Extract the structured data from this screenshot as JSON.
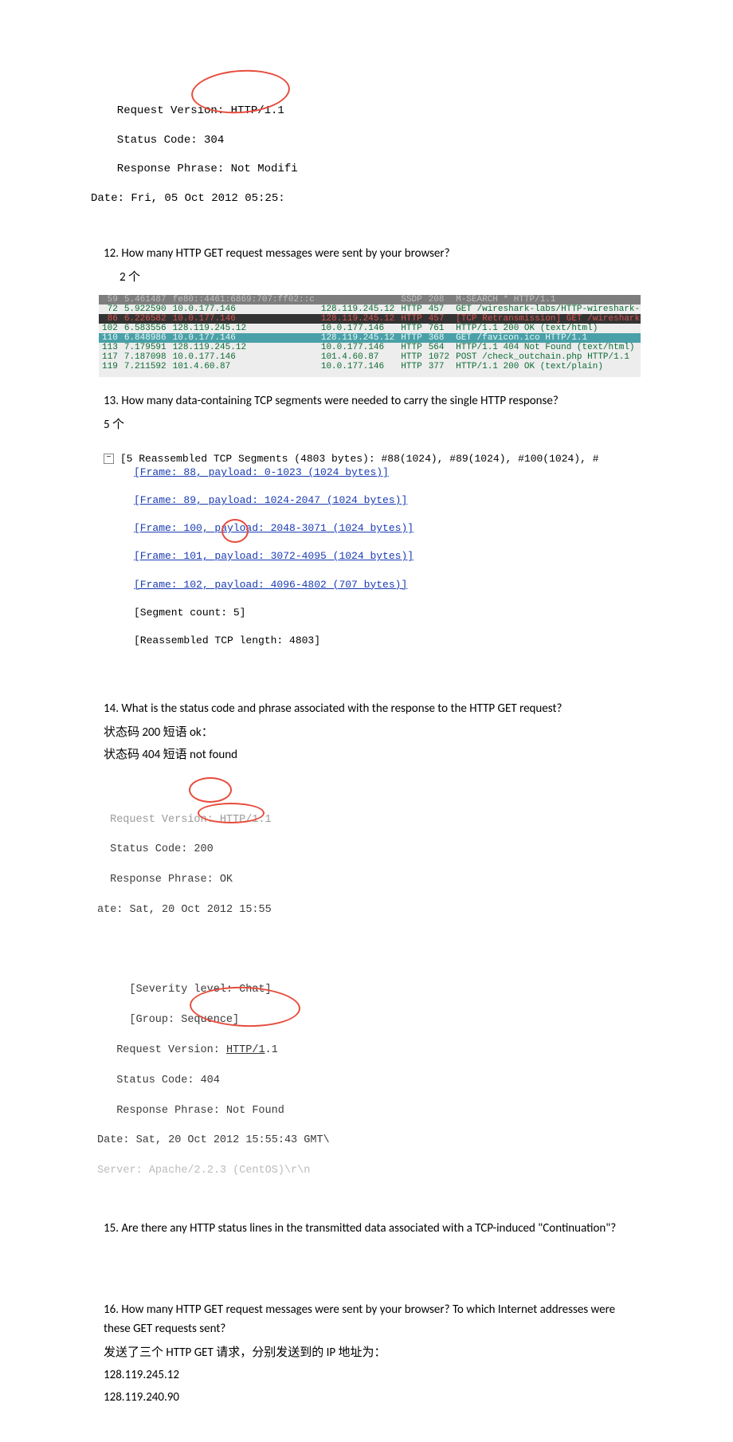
{
  "top_snippet": {
    "l1": "  Request Version: HTTP/1.1",
    "l2": "  Status Code: 304",
    "l3": "  Response Phrase: Not Modifi",
    "l4": "Date: Fri, 05 Oct 2012 05:25:"
  },
  "q12": {
    "q": "12. How many HTTP GET request messages were sent by your browser?",
    "a": "2 个"
  },
  "packets": [
    {
      "no": "59",
      "time": "5.461487",
      "src": "fe80::4461:6869:707:ff02::c",
      "dst": "",
      "proto": "SSDP",
      "len": "208",
      "info": "M-SEARCH * HTTP/1.1",
      "cls": "row-gray"
    },
    {
      "no": "72",
      "time": "5.922590",
      "src": "10.0.177.146",
      "dst": "128.119.245.12",
      "proto": "HTTP",
      "len": "457",
      "info": "GET /wireshark-labs/HTTP-wireshark-file",
      "cls": "row-normal"
    },
    {
      "no": "86",
      "time": "6.226582",
      "src": "10.0.177.146",
      "dst": "128.119.245.12",
      "proto": "HTTP",
      "len": "457",
      "info": "[TCP Retransmission] GET /wireshark-lab",
      "cls": "row-darkred"
    },
    {
      "no": "102",
      "time": "6.583556",
      "src": "128.119.245.12",
      "dst": "10.0.177.146",
      "proto": "HTTP",
      "len": "761",
      "info": "HTTP/1.1 200 OK  (text/html)",
      "cls": "row-normal"
    },
    {
      "no": "110",
      "time": "6.848986",
      "src": "10.0.177.146",
      "dst": "128.119.245.12",
      "proto": "HTTP",
      "len": "368",
      "info": "GET /favicon.ico HTTP/1.1",
      "cls": "row-sel"
    },
    {
      "no": "113",
      "time": "7.179591",
      "src": "128.119.245.12",
      "dst": "10.0.177.146",
      "proto": "HTTP",
      "len": "564",
      "info": "HTTP/1.1 404 Not Found  (text/html)",
      "cls": "row-normal"
    },
    {
      "no": "117",
      "time": "7.187098",
      "src": "10.0.177.146",
      "dst": "101.4.60.87",
      "proto": "HTTP",
      "len": "1072",
      "info": "POST /check_outchain.php HTTP/1.1",
      "cls": "row-normal"
    },
    {
      "no": "119",
      "time": "7.211592",
      "src": "101.4.60.87",
      "dst": "10.0.177.146",
      "proto": "HTTP",
      "len": "377",
      "info": "HTTP/1.1 200 OK  (text/plain)",
      "cls": "row-normal"
    }
  ],
  "q13": {
    "q": "13. How many data-containing TCP segments were needed to carry the single HTTP response?",
    "a": "5 个"
  },
  "segments": {
    "header": "[5 Reassembled TCP Segments (4803 bytes): #88(1024), #89(1024), #100(1024), #",
    "f1": "[Frame: 88, payload: 0-1023 (1024 bytes)]",
    "f2": "[Frame: 89, payload: 1024-2047 (1024 bytes)]",
    "f3": "[Frame: 100, payload: 2048-3071 (1024 bytes)]",
    "f4": "[Frame: 101, payload: 3072-4095 (1024 bytes)]",
    "f5": "[Frame: 102, payload: 4096-4802 (707 bytes)]",
    "seg_count": "[Segment count: 5]",
    "reasm": "[Reassembled TCP length: 4803]"
  },
  "q14": {
    "q": "14. What is the status code and phrase associated with the response to the HTTP GET request?",
    "a1": "状态码 200   短语 ok：",
    "a2": "状态码 404   短语 not  found"
  },
  "snippet200": {
    "l1": " Request Version: HTTP/1.1",
    "l2": " Status Code: 200",
    "l3": " Response Phrase: OK",
    "l4": "ate: Sat, 20 Oct 2012 15:55"
  },
  "snippet404": {
    "l1": "    [Severity level: Chat]",
    "l2": "    [Group: Sequence]",
    "l3": "  Request Version: HTTP/1.1",
    "l4": "  Status Code: 404",
    "l5": "  Response Phrase: Not Found",
    "l6": "Date: Sat, 20 Oct 2012 15:55:43 GMT\\",
    "l7": "Server: Apache/2.2.3 (CentOS)\\r\\n"
  },
  "q15": {
    "q": "15. Are there any HTTP status lines in the transmitted data associated with a TCP-induced \"Continuation\"?"
  },
  "q16": {
    "q": "16. How many HTTP GET request messages were sent by your browser?   To which Internet addresses were these GET requests sent?",
    "a1": "发送了三个 HTTP GET 请求，分别发送到的 IP 地址为：",
    "a2": "128.119.245.12",
    "a3": "128.119.240.90"
  }
}
